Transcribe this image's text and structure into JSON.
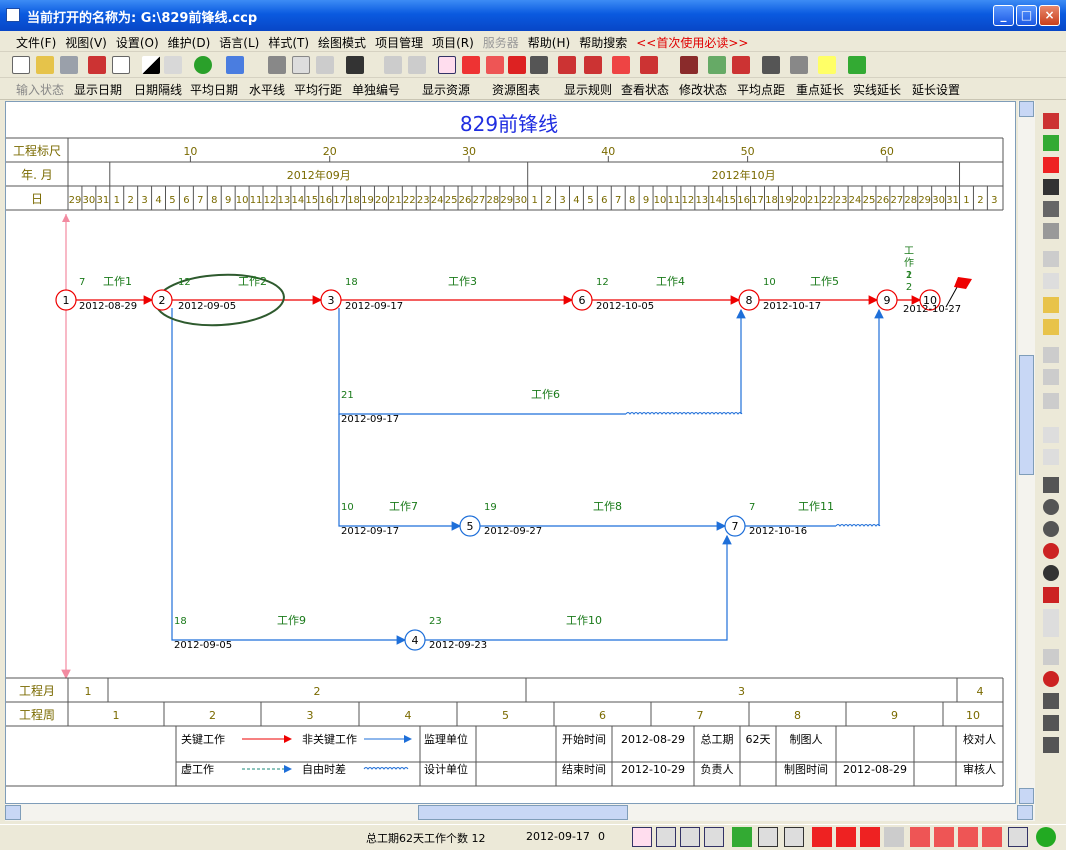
{
  "window": {
    "title": "当前打开的名称为: G:\\829前锋线.ccp"
  },
  "menu": [
    "文件(F)",
    "视图(V)",
    "设置(O)",
    "维护(D)",
    "语言(L)",
    "样式(T)",
    "绘图模式",
    "项目管理",
    "项目(R)",
    "服务器",
    "帮助(H)",
    "帮助搜索",
    "<<首次使用必读>>"
  ],
  "toolbar2": [
    "输入状态",
    "显示日期",
    "日期隔线",
    "平均日期",
    "水平线",
    "平均行距",
    "单独编号",
    "显示资源",
    "资源图表",
    "显示规则",
    "查看状态",
    "修改状态",
    "平均点距",
    "重点延长",
    "实线延长",
    "延长设置"
  ],
  "chart": {
    "title": "829前锋线",
    "scale_label": "工程标尺",
    "scale_ticks": [
      "10",
      "20",
      "30",
      "40",
      "50",
      "60"
    ],
    "ym_label": "年. 月",
    "months": [
      "2012年09月",
      "2012年10月"
    ],
    "day_label": "日",
    "days": [
      "29",
      "30",
      "31",
      "1",
      "2",
      "3",
      "4",
      "5",
      "6",
      "7",
      "8",
      "9",
      "10",
      "11",
      "12",
      "13",
      "14",
      "15",
      "16",
      "17",
      "18",
      "19",
      "20",
      "21",
      "22",
      "23",
      "24",
      "25",
      "26",
      "27",
      "28",
      "29",
      "30",
      "1",
      "2",
      "3",
      "4",
      "5",
      "6",
      "7",
      "8",
      "9",
      "10",
      "11",
      "12",
      "13",
      "14",
      "15",
      "16",
      "17",
      "18",
      "19",
      "20",
      "21",
      "22",
      "23",
      "24",
      "25",
      "26",
      "27",
      "28",
      "29",
      "30",
      "31",
      "1",
      "2",
      "3"
    ],
    "project_month_label": "工程月",
    "project_months": [
      "1",
      "2",
      "3",
      "4"
    ],
    "project_week_label": "工程周",
    "project_weeks": [
      "1",
      "2",
      "3",
      "4",
      "5",
      "6",
      "7",
      "8",
      "9",
      "10"
    ],
    "nodes": [
      "1",
      "2",
      "3",
      "4",
      "5",
      "6",
      "7",
      "8",
      "9",
      "10"
    ],
    "works": [
      {
        "name": "工作1",
        "dur": "7",
        "date": "2012-08-29"
      },
      {
        "name": "工作2",
        "dur": "12",
        "date": "2012-09-05"
      },
      {
        "name": "工作3",
        "dur": "18",
        "date": "2012-09-17"
      },
      {
        "name": "工作4",
        "dur": "12",
        "date": "2012-10-05"
      },
      {
        "name": "工作5",
        "dur": "10",
        "date": "2012-10-17"
      },
      {
        "name": "工作6",
        "dur": "21",
        "date": "2012-09-17"
      },
      {
        "name": "工作7",
        "dur": "10",
        "date": "2012-09-17"
      },
      {
        "name": "工作8",
        "dur": "19",
        "date": "2012-09-27"
      },
      {
        "name": "工作9",
        "dur": "18",
        "date": "2012-09-05"
      },
      {
        "name": "工作10",
        "dur": "23",
        "date": "2012-09-23"
      },
      {
        "name": "工作11",
        "dur": "7",
        "date": "2012-10-16"
      },
      {
        "name": "工作12",
        "dur": "2",
        "date": "2012-10-27"
      }
    ],
    "end_date": "2012-10-27",
    "legend": {
      "critical": "关键工作",
      "noncritical": "非关键工作",
      "dummy": "虚工作",
      "free_float": "自由时差",
      "supervisor": "监理单位",
      "designer": "设计单位",
      "start_label": "开始时间",
      "start": "2012-08-29",
      "total_label": "总工期",
      "total": "62天",
      "drawer": "制图人",
      "checker": "校对人",
      "end_label": "结束时间",
      "end": "2012-10-29",
      "owner": "负责人",
      "draw_time_label": "制图时间",
      "draw_time": "2012-08-29",
      "reviewer": "审核人"
    }
  },
  "status": {
    "summary": "总工期62天工作个数 12",
    "date": "2012-09-17",
    "value": "0"
  },
  "colors": {
    "critical": "#ee0000",
    "noncritical": "#1e6fd9",
    "text_green": "#1a7a1a",
    "title_blue": "#1f2de0",
    "header_gold": "#7a6a00"
  }
}
